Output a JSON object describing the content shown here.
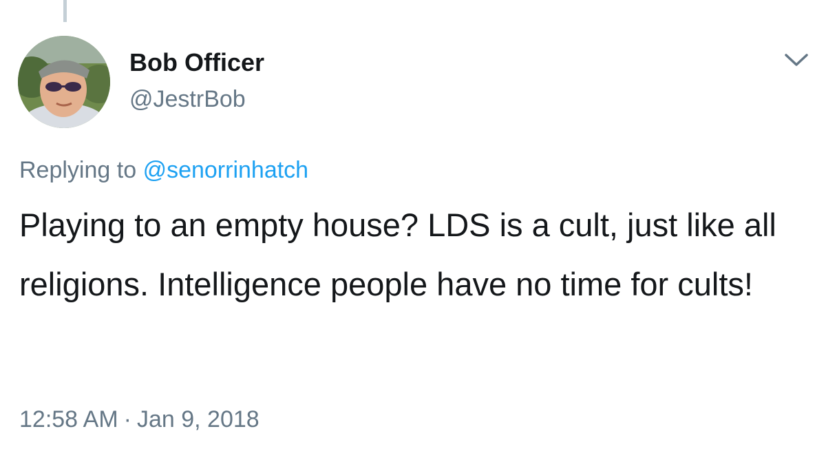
{
  "tweet": {
    "author": {
      "display_name": "Bob Officer",
      "handle": "@JestrBob"
    },
    "reply": {
      "prefix": "Replying to",
      "mention": "@senorrinhatch"
    },
    "text": "Playing to an empty house? LDS is a cult, just like all religions. Intelligence people have no time for cults!",
    "timestamp": {
      "time": "12:58 AM",
      "separator": "·",
      "date": "Jan 9, 2018"
    }
  },
  "icons": {
    "menu": "chevron-down-icon"
  },
  "colors": {
    "text_primary": "#14171a",
    "text_secondary": "#657786",
    "link": "#1da1f2",
    "thread_line": "#c4cfd6"
  }
}
